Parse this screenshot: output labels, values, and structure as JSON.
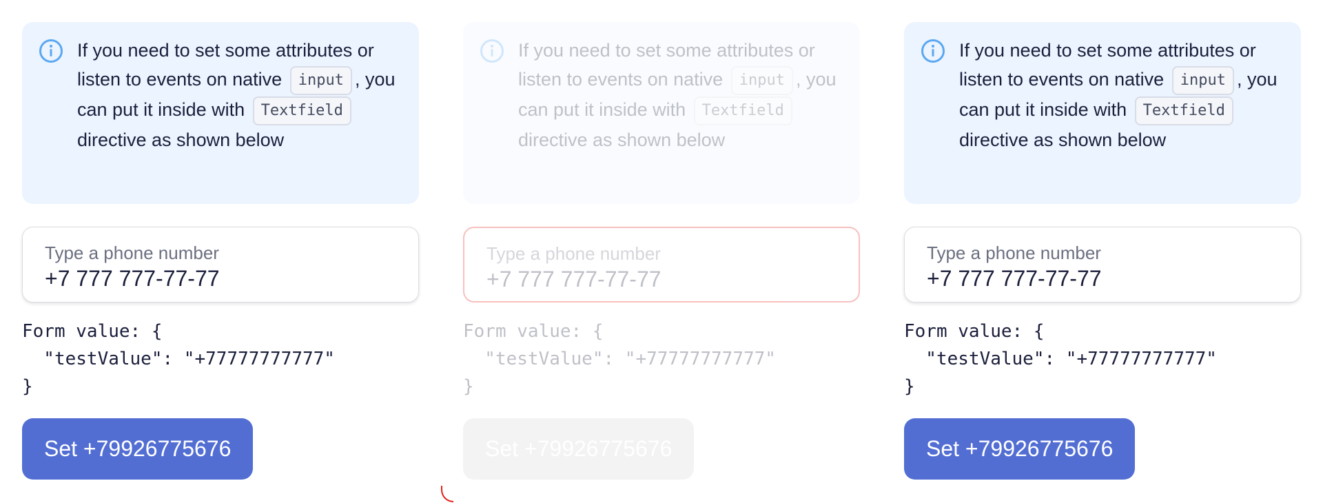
{
  "colors": {
    "notice_bg": "#ebf4ff",
    "info_icon": "#5aa7f2",
    "button_bg": "#526ed3",
    "invalid_border": "#e01f19"
  },
  "notice": {
    "icon": "info-icon",
    "text_part1": "If you need to set some attributes or listen to events on native",
    "chip_input": "input",
    "text_part2": ", you can put it inside with",
    "chip_textfield": "Textfield",
    "text_part3": "directive as shown below"
  },
  "field": {
    "label": "Type a phone number",
    "value": "+7 777 777-77-77"
  },
  "form_value": {
    "line1": "Form value: {",
    "line2": "  \"testValue\": \"+77777777777\"",
    "line3": "}"
  },
  "button": {
    "label": "Set +79926775676"
  },
  "panels": [
    {
      "state": "enabled"
    },
    {
      "state": "disabled"
    },
    {
      "state": "enabled"
    }
  ]
}
